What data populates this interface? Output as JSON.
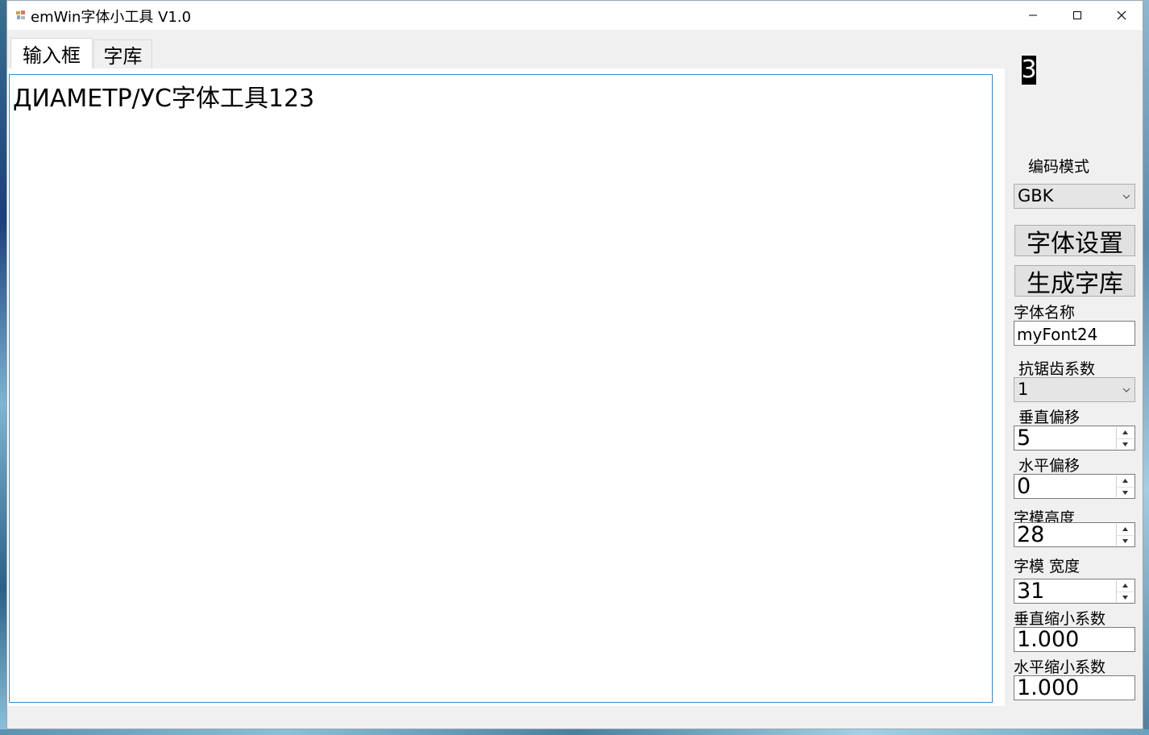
{
  "window": {
    "title": "emWin字体小工具 V1.0"
  },
  "tabs": [
    {
      "label": "输入框",
      "active": true
    },
    {
      "label": "字库",
      "active": false
    }
  ],
  "editor": {
    "text": "ДИАМЕТР/УС字体工具123"
  },
  "preview": {
    "glyph": "3"
  },
  "settings": {
    "encoding_label": "编码模式",
    "encoding_value": "GBK",
    "font_settings_button": "字体设置",
    "generate_button": "生成字库",
    "font_name_label": "字体名称",
    "font_name_value": "myFont24",
    "antialias_label": "抗锯齿系数",
    "antialias_value": "1",
    "v_offset_label": "垂直偏移",
    "v_offset_value": "5",
    "h_offset_label": "水平偏移",
    "h_offset_value": "0",
    "glyph_height_label": "字模高度",
    "glyph_height_value": "28",
    "glyph_width_label": "字模 宽度",
    "glyph_width_value": "31",
    "v_scale_label": "垂直缩小系数",
    "v_scale_value": "1.000",
    "h_scale_label": "水平缩小系数",
    "h_scale_value": "1.000"
  },
  "icons": {
    "app": "app-icon",
    "minimize": "minimize-icon",
    "maximize": "maximize-icon",
    "close": "close-icon",
    "dropdown": "chevron-down-icon",
    "spin_up": "spin-up-icon",
    "spin_down": "spin-down-icon"
  }
}
